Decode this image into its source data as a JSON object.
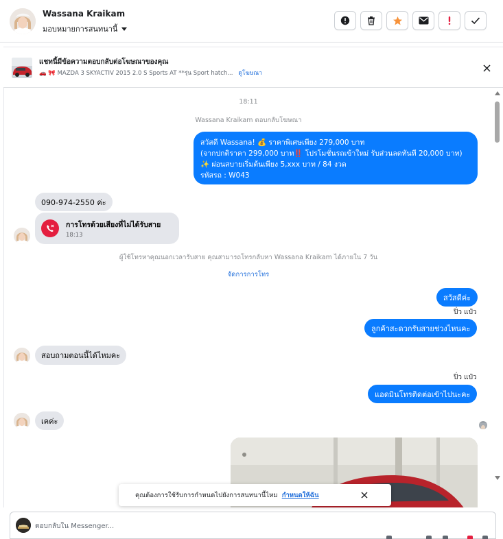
{
  "header": {
    "name": "Wassana Kraikam",
    "assign_label": "มอบหมายการสนทนานี้",
    "tools": [
      {
        "name": "info-icon",
        "color": "#1c1e21"
      },
      {
        "name": "trash-icon",
        "color": "#1c1e21"
      },
      {
        "name": "star-icon",
        "color": "#f7923a"
      },
      {
        "name": "envelope-icon",
        "color": "#1c1e21"
      },
      {
        "name": "exclamation-icon",
        "color": "#e41e3f"
      },
      {
        "name": "check-icon",
        "color": "#1c1e21"
      }
    ]
  },
  "ad_banner": {
    "title": "แชทนี้มีข้อความตอบกลับต่อโฆษณาของคุณ",
    "description": "🚗 🎀 MAZDA 3 SKYACTIV 2015 2.0 S Sports AT **รุ่น Sport hatch...",
    "link_label": "ดูโฆษณา"
  },
  "conversation": {
    "timestamp": "18:11",
    "ad_reply_note": "Wassana Kraikam ตอบกลับโฆษณา",
    "offer_lines": [
      "สวัสดี Wassana! 💰 ราคาพิเศษเพียง 279,000 บาท",
      "(จากปกติราคา 299,000 บาท‼️ โปรโมชั่นรถเข้าใหม่ รับส่วนลดทันที 20,000 บาท)",
      "✨ ผ่อนสบายเริ่มต้นเพียง 5,xxx บาท / 84 งวด",
      "รหัสรถ : W043"
    ],
    "phone_message": "090-974-2550 ค่ะ",
    "missed_call": {
      "title": "การโทรด้วยเสียงที่ไม่ได้รับสาย",
      "time": "18:13"
    },
    "call_notice": "ผู้ใช้โทรหาคุณนอกเวลารับสาย คุณสามารถโทรกลับหา Wassana Kraikam ได้ภายใน 7 วัน",
    "manage_calls_link": "จัดการการโทร",
    "reply_hello": "สวัสดีค่ะ",
    "sender_name_1": "ปิ่ว แป๋ว",
    "reply_ask_time": "ลูกค้าสะดวกรับสายช่วงไหนคะ",
    "customer_ask_now": "สอบถามตอนนี้ได้ไหมคะ",
    "sender_name_2": "ปิ่ว แป๋ว",
    "reply_admin_call": "แอดมินโทรติดต่อเข้าไปนะคะ",
    "customer_ok": "เคค่ะ"
  },
  "toast": {
    "message": "คุณต้องการใช้รับการกำหนดไปยังการสนทนานี้ไหม",
    "link_label": "กำหนดให้ฉัน"
  },
  "composer": {
    "placeholder": "ตอบกลับใน Messenger..."
  },
  "colors": {
    "accent_blue": "#0a7cff",
    "incoming_bubble": "#e4e6eb",
    "link_blue": "#216fdb",
    "missed_call_red": "#e41e3f"
  }
}
